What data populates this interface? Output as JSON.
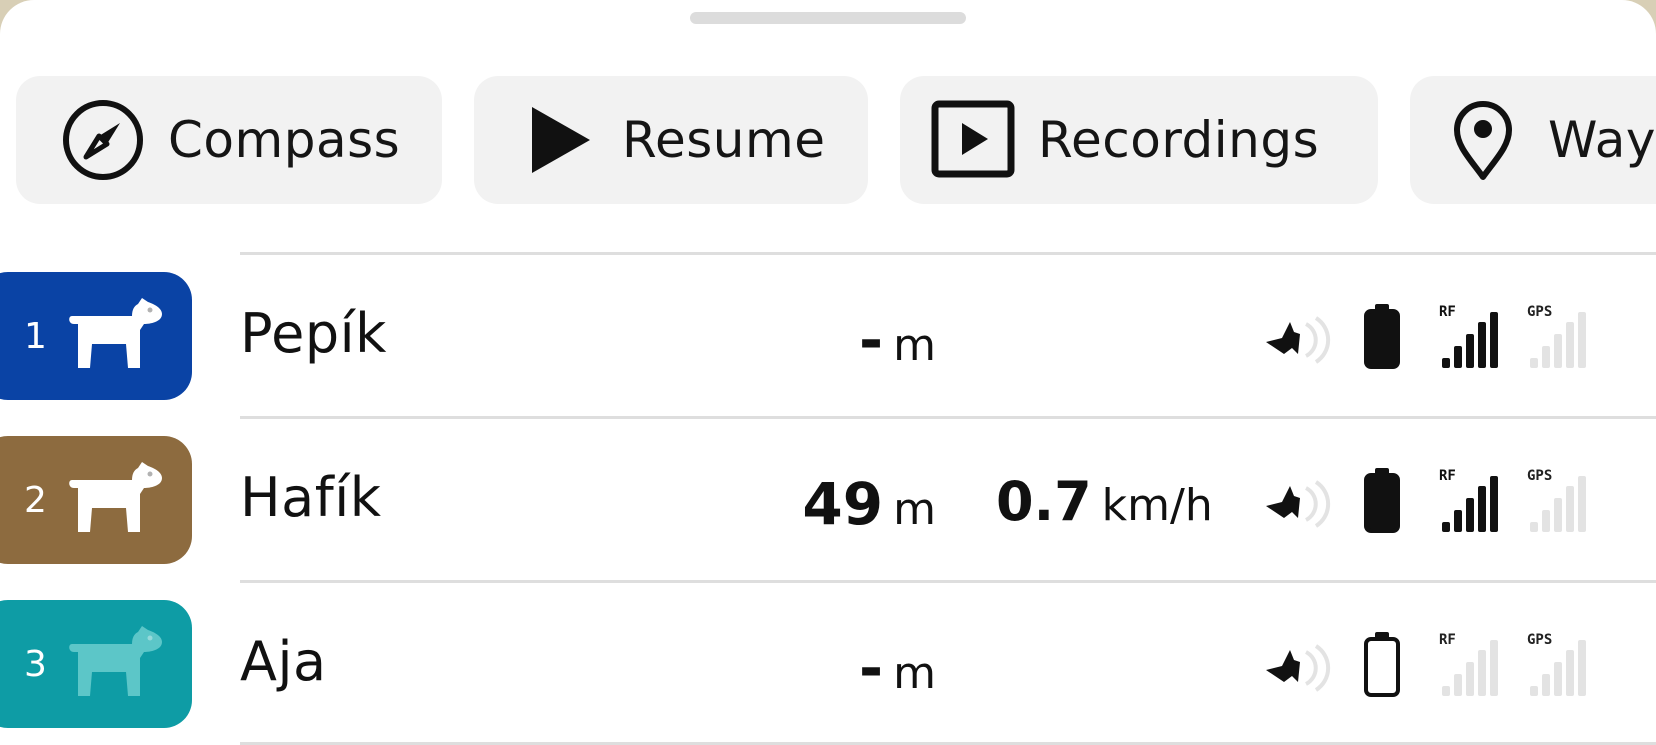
{
  "toolbar": {
    "compass_label": "Compass",
    "resume_label": "Resume",
    "recordings_label": "Recordings",
    "waypoints_label": "Way"
  },
  "dogs": [
    {
      "number": "1",
      "name": "Pepík",
      "distance_value": "-",
      "distance_unit": "m",
      "speed_value": "",
      "speed_unit": "",
      "badge_color": "#0a43a5",
      "battery_level": 0.85,
      "rf_bars": 4,
      "gps_bars": 0,
      "rf_label": "RF",
      "gps_label": "GPS"
    },
    {
      "number": "2",
      "name": "Hafík",
      "distance_value": "49",
      "distance_unit": "m",
      "speed_value": "0.7",
      "speed_unit": "km/h",
      "badge_color": "#8d6b3f",
      "battery_level": 0.85,
      "rf_bars": 4,
      "gps_bars": 0,
      "rf_label": "RF",
      "gps_label": "GPS"
    },
    {
      "number": "3",
      "name": "Aja",
      "distance_value": "-",
      "distance_unit": "m",
      "speed_value": "",
      "speed_unit": "",
      "badge_color": "#0e9ca5",
      "battery_level": 0,
      "rf_bars": 0,
      "gps_bars": 0,
      "rf_label": "RF",
      "gps_label": "GPS"
    }
  ],
  "icons": {
    "compass": "compass-icon",
    "resume": "play-icon",
    "recordings": "recordings-icon",
    "waypoints": "map-pin-icon",
    "dog": "dog-icon",
    "bark": "bark-signal-icon",
    "battery": "battery-icon",
    "rf": "rf-signal-icon",
    "gps": "gps-signal-icon"
  },
  "colors": {
    "signal_active": "#111111",
    "signal_inactive": "#e3e3e3",
    "chip_bg": "#f2f2f2"
  }
}
